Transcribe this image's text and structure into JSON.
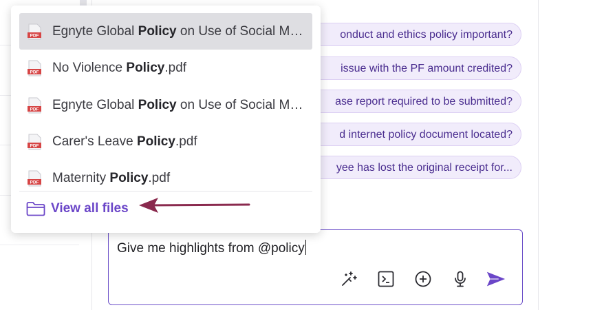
{
  "suggestions": [
    "onduct and ethics policy important?",
    "issue with the PF amount credited?",
    "ase report required to be submitted?",
    "d internet policy document located?",
    "yee has lost the original receipt for..."
  ],
  "composer": {
    "text": "Give me highlights from @policy"
  },
  "dropdown": {
    "items": [
      {
        "pre": "Egnyte Global ",
        "bold": "Policy",
        "post": " on Use of Social Media.pdf"
      },
      {
        "pre": "No Violence ",
        "bold": "Policy",
        "post": ".pdf"
      },
      {
        "pre": "Egnyte Global ",
        "bold": "Policy",
        "post": " on Use of Social Media.pdf"
      },
      {
        "pre": "Carer's Leave ",
        "bold": "Policy",
        "post": ".pdf"
      },
      {
        "pre": "Maternity ",
        "bold": "Policy",
        "post": ".pdf"
      }
    ],
    "icon_label": "PDF",
    "view_all_label": "View all files"
  },
  "colors": {
    "accent": "#6b46c8",
    "arrow": "#8a2a4e",
    "chip_bg": "#f1ecfb",
    "pdf_red": "#d64545"
  },
  "icons": [
    "magic-wand-icon",
    "terminal-icon",
    "plus-circle-icon",
    "microphone-icon",
    "send-icon",
    "folder-icon",
    "pdf-file-icon"
  ]
}
